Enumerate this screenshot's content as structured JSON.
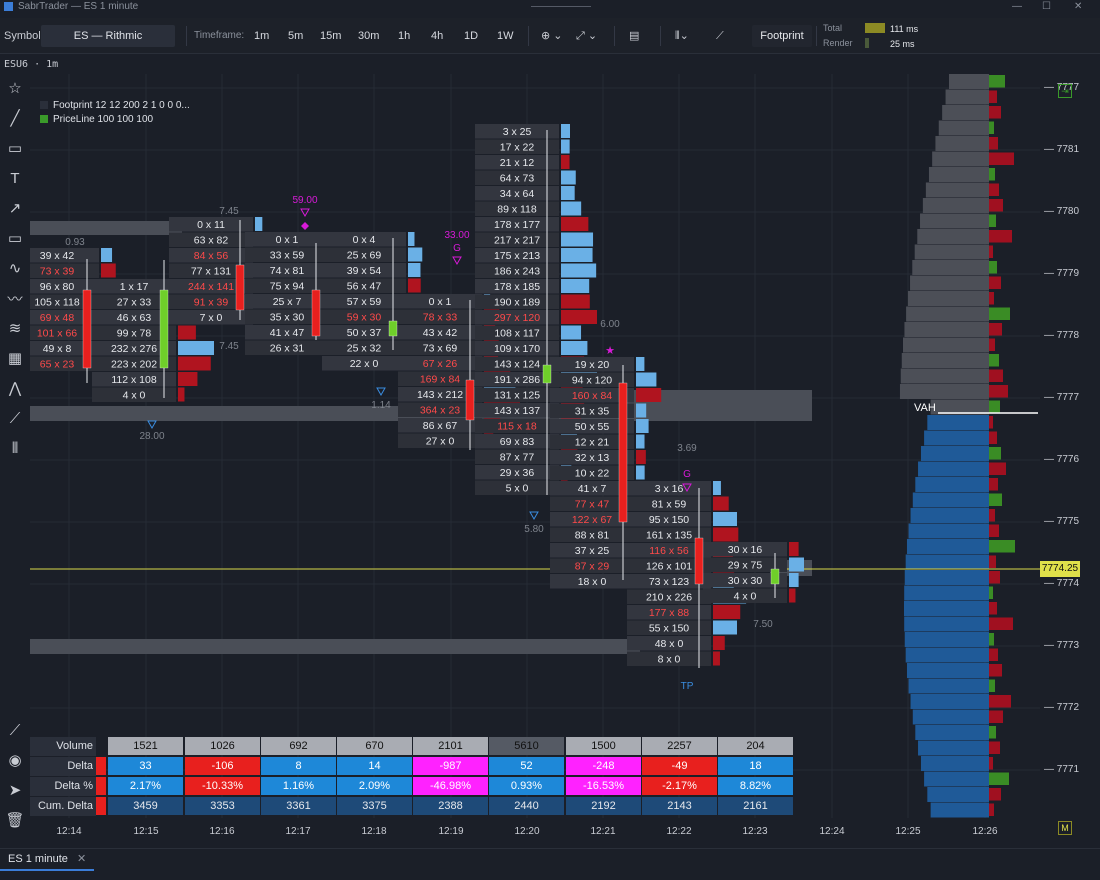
{
  "window": {
    "title": "SabrTrader — ES 1 minute"
  },
  "toolbar": {
    "symbol_label": "Symbol:",
    "symbol_value": "ES — Rithmic",
    "timeframe_label": "Timeframe:",
    "timeframes": [
      "1m",
      "5m",
      "15m",
      "30m",
      "1h",
      "4h",
      "1D",
      "1W"
    ],
    "footprint_label": "Footprint",
    "perf": {
      "total_label": "Total",
      "total_value": "111 ms",
      "render_label": "Render",
      "render_value": "25 ms"
    }
  },
  "subheader": "ESU6 · 1m",
  "legend": [
    {
      "label": "Footprint 12 12 200 2 1 0 0 0...",
      "color": "#2a2f3a"
    },
    {
      "label": "PriceLine 100 100 100",
      "color": "#3a9a2a"
    }
  ],
  "chart_data": {
    "type": "footprint",
    "price_axis": [
      "7777",
      "7781",
      "7780",
      "7779",
      "7778",
      "7777",
      "7776",
      "7775",
      "7774",
      "7773",
      "7772",
      "7771"
    ],
    "current_price": "7774.25",
    "time_axis": [
      "12:14",
      "12:15",
      "12:16",
      "12:17",
      "12:18",
      "12:19",
      "12:20",
      "12:21",
      "12:22",
      "12:23",
      "12:24",
      "12:25",
      "12:26"
    ],
    "markers": {
      "vah": "VAH",
      "tp": "TP",
      "g": "G",
      "values": [
        "7.45",
        "59.00",
        "0.93",
        "33.00",
        "7.45",
        "28.00",
        "1.14",
        "6.00",
        "3.69",
        "5.80",
        "7.50"
      ]
    },
    "bars": [
      {
        "time": "12:15",
        "rows": [
          "39 x 42",
          "73 x 39",
          "96 x 80",
          "105 x 118",
          "69 x 48",
          "101 x 66",
          "49 x 8",
          "65 x 23"
        ]
      },
      {
        "time": "12:15b",
        "rows": [
          "1 x 17",
          "27 x 33",
          "46 x 63",
          "99 x 78",
          "232 x 276",
          "223 x 202",
          "112 x 108",
          "4 x 0"
        ]
      },
      {
        "time": "12:16",
        "rows": [
          "0 x 11",
          "63 x 82",
          "84 x 56",
          "77 x 131",
          "244 x 141",
          "91 x 39",
          "7 x 0"
        ]
      },
      {
        "time": "12:17",
        "rows": [
          "0 x 1",
          "33 x 59",
          "74 x 81",
          "75 x 94",
          "25 x 7",
          "35 x 30",
          "41 x 47",
          "26 x 31"
        ]
      },
      {
        "time": "12:18",
        "rows": [
          "0 x 4",
          "25 x 69",
          "39 x 54",
          "56 x 47",
          "57 x 59",
          "59 x 30",
          "50 x 37",
          "25 x 32",
          "22 x 0"
        ]
      },
      {
        "time": "12:19",
        "rows": [
          "0 x 1",
          "78 x 33",
          "43 x 42",
          "73 x 69",
          "67 x 26",
          "169 x 84",
          "143 x 212",
          "364 x 23",
          "86 x 67",
          "27 x 0"
        ]
      },
      {
        "time": "12:20",
        "rows": [
          "3 x 25",
          "17 x 22",
          "21 x 12",
          "64 x 73",
          "34 x 64",
          "89 x 118",
          "178 x 177",
          "217 x 217",
          "175 x 213",
          "186 x 243",
          "178 x 185",
          "190 x 189",
          "297 x 120",
          "108 x 117",
          "109 x 170",
          "143 x 124",
          "191 x 286",
          "131 x 125",
          "143 x 137",
          "115 x 18",
          "69 x 83",
          "87 x 77",
          "29 x 36",
          "5 x 0"
        ]
      },
      {
        "time": "12:21",
        "rows": [
          "19 x 20",
          "94 x 120",
          "160 x 84",
          "31 x 35",
          "50 x 55",
          "12 x 21",
          "32 x 13",
          "10 x 22",
          "41 x 7",
          "77 x 47",
          "122 x 67",
          "88 x 81",
          "37 x 25",
          "87 x 29",
          "18 x 0"
        ]
      },
      {
        "time": "12:22",
        "rows": [
          "3 x 16",
          "81 x 59",
          "95 x 150",
          "161 x 135",
          "116 x 56",
          "126 x 101",
          "73 x 123",
          "210 x 226",
          "177 x 88",
          "55 x 150",
          "48 x 0",
          "8 x 0"
        ]
      },
      {
        "time": "12:23",
        "rows": [
          "30 x 16",
          "29 x 75",
          "30 x 30",
          "4 x 0"
        ]
      }
    ],
    "stats_table": {
      "labels": [
        "Volume",
        "Delta",
        "Delta %",
        "Cum. Delta"
      ],
      "volume": [
        "1521",
        "1026",
        "692",
        "670",
        "2101",
        "5610",
        "1500",
        "2257",
        "204"
      ],
      "delta": [
        "33",
        "-106",
        "8",
        "14",
        "-987",
        "52",
        "-248",
        "-49",
        "18"
      ],
      "delta_pct": [
        "2.17%",
        "-10.33%",
        "1.16%",
        "2.09%",
        "-46.98%",
        "0.93%",
        "-16.53%",
        "-2.17%",
        "8.82%"
      ],
      "cum_delta": [
        "3459",
        "3353",
        "3361",
        "3375",
        "2388",
        "2440",
        "2192",
        "2143",
        "2161"
      ]
    }
  },
  "tab": {
    "label": "ES 1 minute"
  },
  "buttons": {
    "m_label": "M"
  }
}
